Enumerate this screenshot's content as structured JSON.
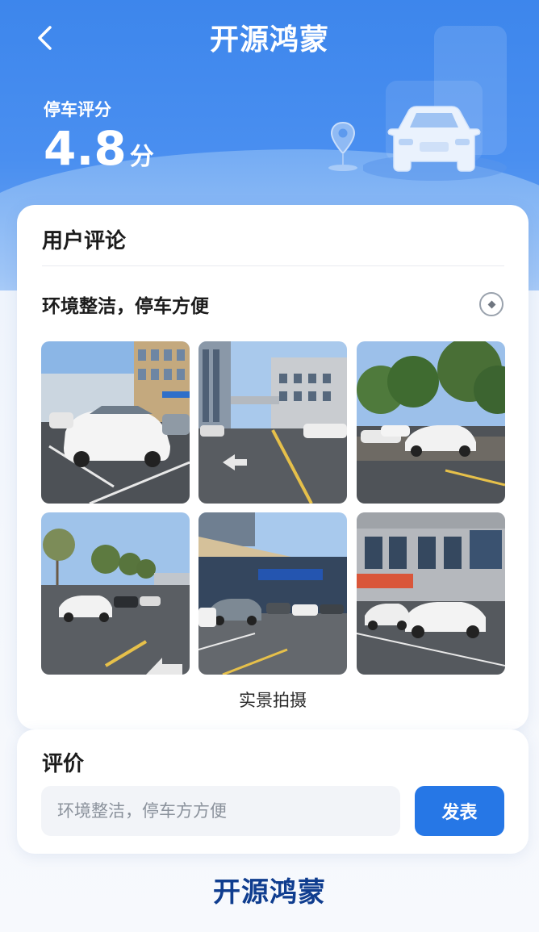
{
  "header": {
    "title": "开源鸿蒙",
    "score_label": "停车评分",
    "score_value": "4.8",
    "score_unit": "分"
  },
  "comments": {
    "section_title": "用户评论",
    "items": [
      {
        "text": "环境整洁，停车方便"
      }
    ],
    "photo_caption": "实景拍摄"
  },
  "review": {
    "title": "评价",
    "input_placeholder": "环境整洁，停车方方便",
    "submit_label": "发表"
  },
  "footer": {
    "brand": "开源鸿蒙"
  },
  "colors": {
    "header_blue": "#3d86ec",
    "button_blue": "#2677e6",
    "footer_brand": "#0f3d8f"
  },
  "icons": [
    "back-arrow-icon",
    "location-pin-icon",
    "car-icon",
    "more-options-icon"
  ]
}
